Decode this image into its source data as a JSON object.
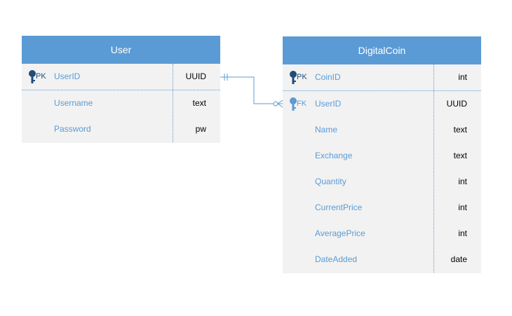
{
  "entities": {
    "user": {
      "title": "User",
      "rows": [
        {
          "key": "PK",
          "name": "UserID",
          "type": "UUID"
        },
        {
          "key": "",
          "name": "Username",
          "type": "text"
        },
        {
          "key": "",
          "name": "Password",
          "type": "pw"
        }
      ]
    },
    "coin": {
      "title": "DigitalCoin",
      "rows": [
        {
          "key": "PK",
          "name": "CoinID",
          "type": "int"
        },
        {
          "key": "FK",
          "name": "UserID",
          "type": "UUID"
        },
        {
          "key": "",
          "name": "Name",
          "type": "text"
        },
        {
          "key": "",
          "name": "Exchange",
          "type": "text"
        },
        {
          "key": "",
          "name": "Quantity",
          "type": "int"
        },
        {
          "key": "",
          "name": "CurrentPrice",
          "type": "int"
        },
        {
          "key": "",
          "name": "AveragePrice",
          "type": "int"
        },
        {
          "key": "",
          "name": "DateAdded",
          "type": "date"
        }
      ]
    }
  },
  "relationship": {
    "from_cardinality": "one-and-only-one",
    "to_cardinality": "zero-or-many"
  },
  "colors": {
    "header": "#5b9bd5",
    "body": "#f2f2f2",
    "key": "#1f4e79",
    "attribute": "#5b9bd5",
    "connector": "#5b9bd5"
  },
  "icons": {
    "key": "key-icon"
  }
}
